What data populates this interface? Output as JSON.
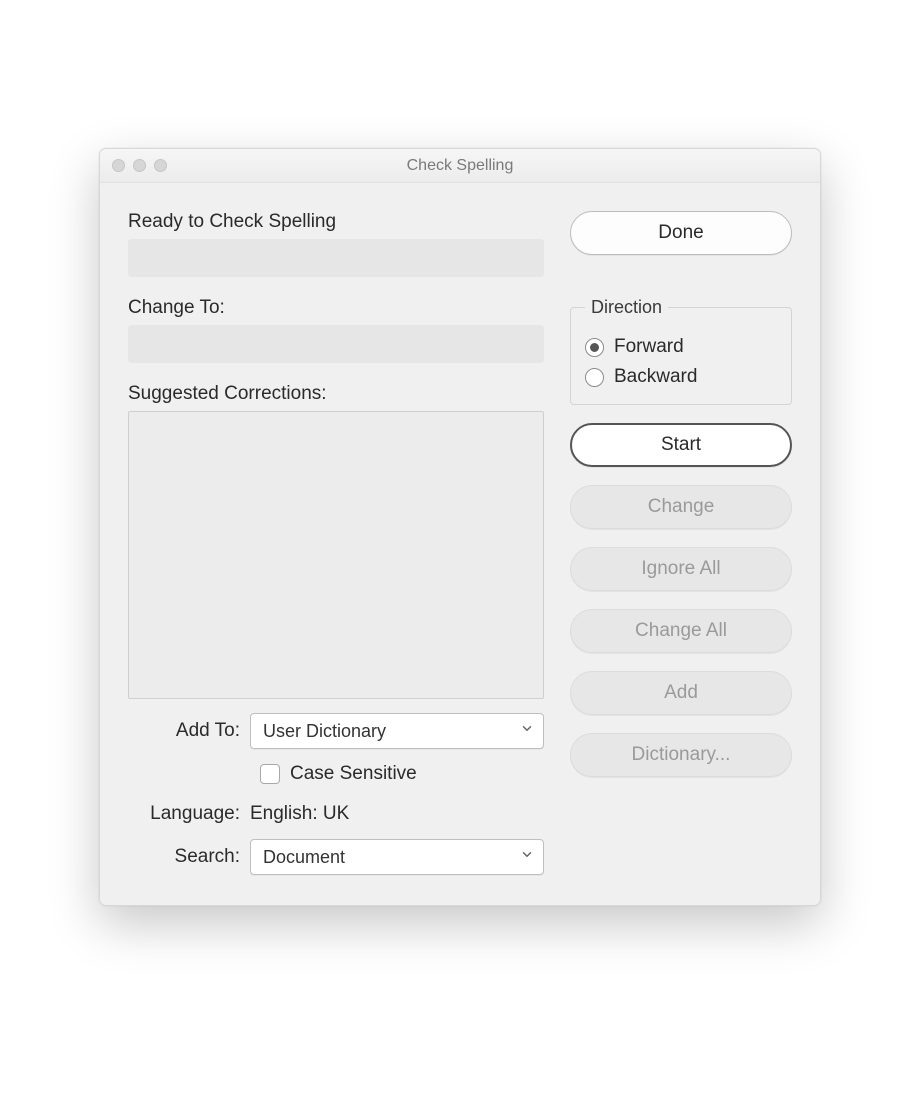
{
  "window": {
    "title": "Check Spelling"
  },
  "left": {
    "ready_label": "Ready to Check Spelling",
    "change_to_label": "Change To:",
    "suggestions_label": "Suggested Corrections:",
    "add_to_label": "Add To:",
    "add_to_value": "User Dictionary",
    "case_sensitive_label": "Case Sensitive",
    "case_sensitive_checked": false,
    "language_label": "Language:",
    "language_value": "English: UK",
    "search_label": "Search:",
    "search_value": "Document"
  },
  "right": {
    "done": "Done",
    "direction_label": "Direction",
    "forward": "Forward",
    "backward": "Backward",
    "direction_selected": "forward",
    "start": "Start",
    "change": "Change",
    "ignore_all": "Ignore All",
    "change_all": "Change All",
    "add": "Add",
    "dictionary": "Dictionary..."
  }
}
